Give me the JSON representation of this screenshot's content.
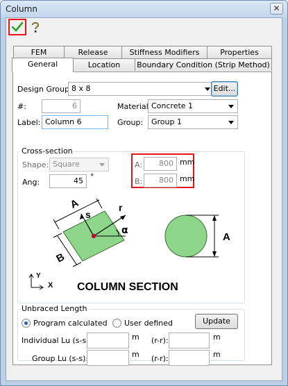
{
  "window": {
    "title": "Column",
    "close_glyph": "✕"
  },
  "toolbar": {
    "ok_icon": "check-icon",
    "help_icon": "help-icon"
  },
  "tabs": {
    "row1": [
      "FEM",
      "Release",
      "Stiffness Modifiers",
      "Properties"
    ],
    "row2": [
      "General",
      "Location",
      "Boundary Condition (Strip Method)"
    ],
    "active": "General"
  },
  "general": {
    "design_group_label": "Design Group:",
    "design_group_value": "8 x 8",
    "edit_button": "Edit...",
    "number_label": "#:",
    "number_value": "6",
    "label_label": "Label:",
    "label_value": "Column 6",
    "material_label": "Material:",
    "material_value": "Concrete 1",
    "group_label": "Group:",
    "group_value": "Group 1"
  },
  "cross_section": {
    "title": "Cross-section",
    "shape_label": "Shape:",
    "shape_value": "Square",
    "ang_label": "Ang:",
    "ang_value": "45",
    "ang_unit": "°",
    "a_label": "A:",
    "a_value": "800",
    "a_unit": "mm",
    "b_label": "B:",
    "b_value": "800",
    "b_unit": "mm",
    "diagram": {
      "caption": "COLUMN SECTION",
      "label_A": "A",
      "label_B": "B",
      "label_s": "s",
      "label_r": "r",
      "label_alpha": "α",
      "label_circle_A": "A",
      "axis_x": "X",
      "axis_y": "Y",
      "fill_color": "#8ed68a"
    }
  },
  "unbraced": {
    "title": "Unbraced Length",
    "radio_program": "Program calculated",
    "radio_user": "User defined",
    "selected": "Program calculated",
    "update_button": "Update",
    "individual_label": "Individual Lu (s-s):",
    "individual_unit": "m",
    "individual_rr_label": "(r-r):",
    "individual_rr_unit": "m",
    "group_label": "Group Lu (s-s):",
    "group_unit": "m",
    "group_rr_label": "(r-r):",
    "group_rr_unit": "m"
  }
}
